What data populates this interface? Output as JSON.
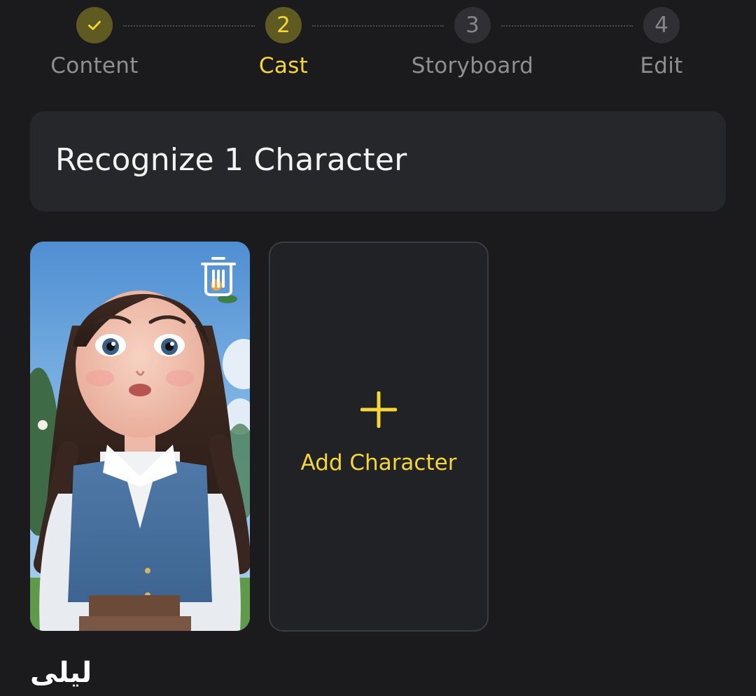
{
  "stepper": {
    "steps": [
      {
        "number": "1",
        "label": "Content",
        "state": "done",
        "icon": "check-icon"
      },
      {
        "number": "2",
        "label": "Cast",
        "state": "active"
      },
      {
        "number": "3",
        "label": "Storyboard",
        "state": "pending"
      },
      {
        "number": "4",
        "label": "Edit",
        "state": "pending"
      }
    ]
  },
  "header": {
    "title": "Recognize 1 Character"
  },
  "characters": [
    {
      "name": "ليلى",
      "delete_icon": "trash-icon"
    }
  ],
  "add_card": {
    "label": "Add Character",
    "icon": "plus-icon"
  },
  "colors": {
    "background": "#1b1b1e",
    "card": "#26272b",
    "accent": "#f4d63a",
    "accent_dim": "#5f5a22",
    "muted_text": "#8e8e93"
  }
}
